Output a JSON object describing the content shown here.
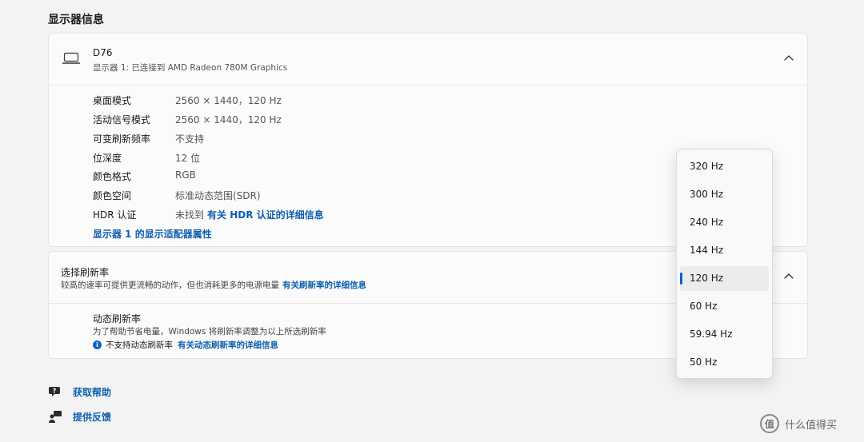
{
  "section_title": "显示器信息",
  "display_card": {
    "device_name": "D76",
    "device_sub": "显示器 1: 已连接到 AMD Radeon 780M Graphics",
    "rows": [
      {
        "label": "桌面模式",
        "value": "2560 × 1440，120 Hz"
      },
      {
        "label": "活动信号模式",
        "value": "2560 × 1440，120 Hz"
      },
      {
        "label": "可变刷新频率",
        "value": "不支持"
      },
      {
        "label": "位深度",
        "value": "12 位"
      },
      {
        "label": "颜色格式",
        "value": "RGB"
      },
      {
        "label": "颜色空间",
        "value": "标准动态范围(SDR)"
      },
      {
        "label": "HDR 认证",
        "value": "未找到",
        "link": "有关 HDR 认证的详细信息"
      }
    ],
    "adapter_link": "显示器 1 的显示适配器属性"
  },
  "refresh_card": {
    "title": "选择刷新率",
    "description": "较高的速率可提供更流畅的动作，但也消耗更多的电源电量",
    "description_link": "有关刷新率的详细信息",
    "dynamic_title": "动态刷新率",
    "dynamic_description": "为了帮助节省电量，Windows 将刷新率调整为以上所选刷新率",
    "dynamic_status": "不支持动态刷新率",
    "dynamic_link": "有关动态刷新率的详细信息"
  },
  "refresh_options": [
    "320 Hz",
    "300 Hz",
    "240 Hz",
    "144 Hz",
    "120 Hz",
    "60 Hz",
    "59.94 Hz",
    "50 Hz"
  ],
  "selected_refresh": "120 Hz",
  "footer": {
    "help": "获取帮助",
    "feedback": "提供反馈"
  },
  "watermark": {
    "logo": "值",
    "text": "什么值得买"
  },
  "accent_color": "#0b63c4",
  "link_color": "#0e5fb0"
}
